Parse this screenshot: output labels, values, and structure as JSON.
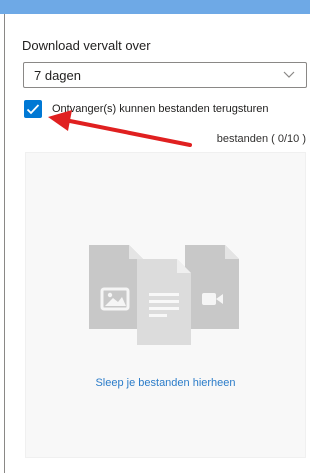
{
  "expiry": {
    "heading": "Download vervalt over",
    "selected_value": "7 dagen"
  },
  "return_files": {
    "label": "Ontvanger(s) kunnen bestanden terugsturen",
    "checked": true
  },
  "files": {
    "count_label": "bestanden ( 0/10 )"
  },
  "drop_zone": {
    "text": "Sleep je bestanden hierheen"
  },
  "colors": {
    "accent": "#0078d4",
    "link": "#2b7cc9",
    "annotation_arrow": "#e02020",
    "top_strip": "#6ea9e6"
  },
  "icons": [
    "chevron-down-icon",
    "checkmark-icon",
    "image-file-icon",
    "document-file-icon",
    "video-file-icon"
  ]
}
